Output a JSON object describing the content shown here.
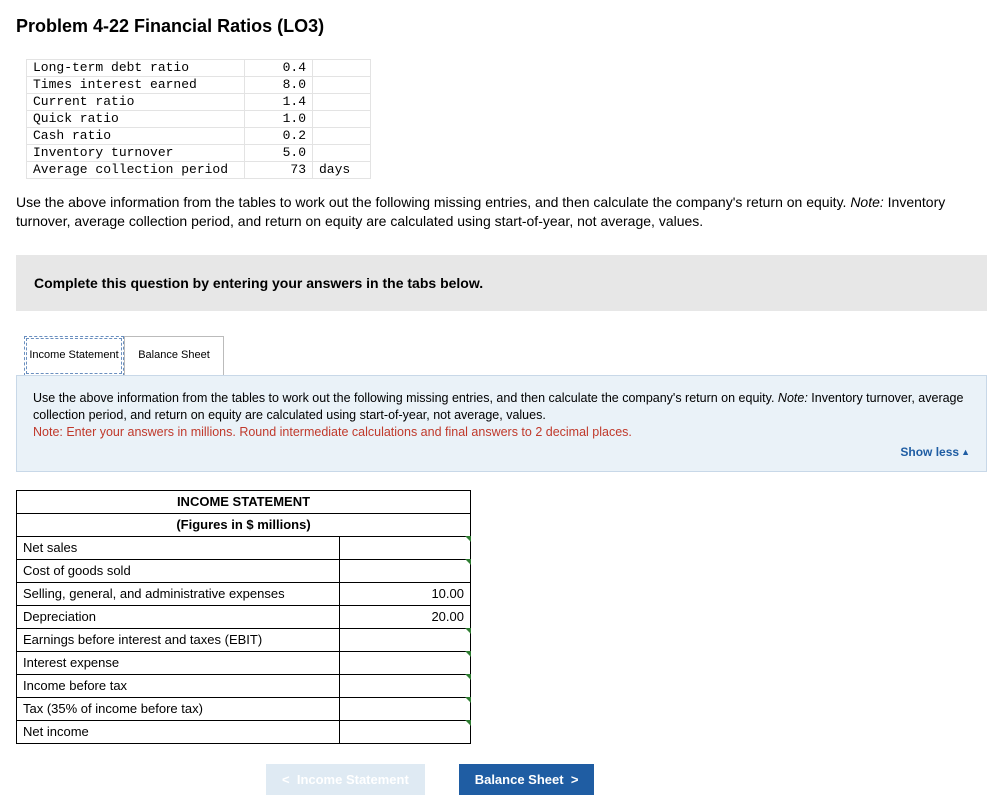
{
  "title": "Problem 4-22 Financial Ratios (LO3)",
  "ratios": [
    {
      "label": "Long-term debt ratio",
      "value": "0.4",
      "unit": ""
    },
    {
      "label": "Times interest earned",
      "value": "8.0",
      "unit": ""
    },
    {
      "label": "Current ratio",
      "value": "1.4",
      "unit": ""
    },
    {
      "label": "Quick ratio",
      "value": "1.0",
      "unit": ""
    },
    {
      "label": "Cash ratio",
      "value": "0.2",
      "unit": ""
    },
    {
      "label": "Inventory turnover",
      "value": "5.0",
      "unit": ""
    },
    {
      "label": "Average collection period",
      "value": "73",
      "unit": "days"
    }
  ],
  "intro_1": "Use the above information from the tables to work out the following missing entries, and then calculate the company's return on equity. ",
  "intro_note_label": "Note:",
  "intro_2": " Inventory turnover, average collection period, and return on equity are calculated using start-of-year, not average, values.",
  "prompt": "Complete this question by entering your answers in the tabs below.",
  "tabs": {
    "t1": "Income Statement",
    "t2": "Balance Sheet"
  },
  "box_1": "Use the above information from the tables to work out the following missing entries, and then calculate the company's return on equity. ",
  "box_note_label": "Note:",
  "box_2": " Inventory turnover, average collection period, and return on equity are calculated using start-of-year, not average, values.",
  "box_red": "Note: Enter your answers in millions. Round intermediate calculations and final answers to 2 decimal places.",
  "show_less": "Show less",
  "is_header1": "INCOME STATEMENT",
  "is_header2": "(Figures in $ millions)",
  "is_rows": [
    {
      "label": "Net sales",
      "value": "",
      "input": true
    },
    {
      "label": "Cost of goods sold",
      "value": "",
      "input": true
    },
    {
      "label": "Selling, general, and administrative expenses",
      "value": "10.00",
      "input": false
    },
    {
      "label": "Depreciation",
      "value": "20.00",
      "input": false
    },
    {
      "label": "Earnings before interest and taxes (EBIT)",
      "value": "",
      "input": true
    },
    {
      "label": "Interest expense",
      "value": "",
      "input": true
    },
    {
      "label": "Income before tax",
      "value": "",
      "input": true
    },
    {
      "label": "Tax (35% of income before tax)",
      "value": "",
      "input": true
    },
    {
      "label": "Net income",
      "value": "",
      "input": true
    }
  ],
  "nav": {
    "prev": "Income Statement",
    "next": "Balance Sheet"
  }
}
